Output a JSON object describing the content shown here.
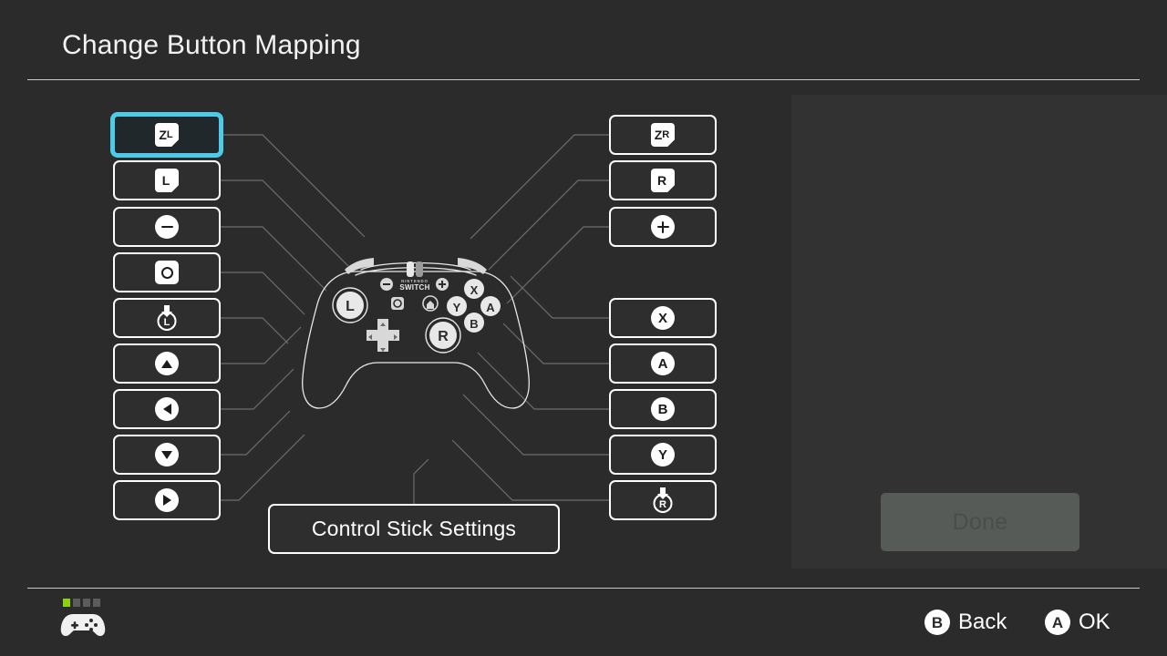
{
  "header": {
    "title": "Change Button Mapping"
  },
  "left_column": [
    {
      "id": "zl",
      "label": "ZL",
      "icon": "shoulder-zl-icon",
      "glyph": "shoulder",
      "main": "Z",
      "sub": "L",
      "selected": true
    },
    {
      "id": "l",
      "label": "L",
      "icon": "shoulder-l-icon",
      "glyph": "shoulder",
      "main": "L",
      "sub": "",
      "selected": false
    },
    {
      "id": "minus",
      "label": "Minus",
      "icon": "minus-button-icon",
      "glyph": "minus",
      "main": "",
      "sub": "",
      "selected": false
    },
    {
      "id": "capture",
      "label": "Capture",
      "icon": "capture-button-icon",
      "glyph": "capture",
      "main": "",
      "sub": "",
      "selected": false
    },
    {
      "id": "lstick",
      "label": "L Stick Press",
      "icon": "left-stick-press-icon",
      "glyph": "stick",
      "main": "L",
      "sub": "",
      "selected": false
    },
    {
      "id": "dup",
      "label": "D-Pad Up",
      "icon": "dpad-up-icon",
      "glyph": "tri-up",
      "main": "",
      "sub": "",
      "selected": false
    },
    {
      "id": "dleft",
      "label": "D-Pad Left",
      "icon": "dpad-left-icon",
      "glyph": "tri-left",
      "main": "",
      "sub": "",
      "selected": false
    },
    {
      "id": "ddown",
      "label": "D-Pad Down",
      "icon": "dpad-down-icon",
      "glyph": "tri-down",
      "main": "",
      "sub": "",
      "selected": false
    },
    {
      "id": "dright",
      "label": "D-Pad Right",
      "icon": "dpad-right-icon",
      "glyph": "tri-right",
      "main": "",
      "sub": "",
      "selected": false
    }
  ],
  "right_column": [
    {
      "id": "zr",
      "label": "ZR",
      "icon": "shoulder-zr-icon",
      "glyph": "shoulder",
      "main": "Z",
      "sub": "R",
      "selected": false
    },
    {
      "id": "r",
      "label": "R",
      "icon": "shoulder-r-icon",
      "glyph": "shoulder",
      "main": "R",
      "sub": "",
      "selected": false
    },
    {
      "id": "plus",
      "label": "Plus",
      "icon": "plus-button-icon",
      "glyph": "plus",
      "main": "",
      "sub": "",
      "selected": false
    },
    {
      "id": "gap",
      "label": "",
      "icon": "",
      "glyph": "gap",
      "main": "",
      "sub": "",
      "selected": false
    },
    {
      "id": "x",
      "label": "X",
      "icon": "x-button-icon",
      "glyph": "letter",
      "main": "X",
      "sub": "",
      "selected": false
    },
    {
      "id": "a",
      "label": "A",
      "icon": "a-button-icon",
      "glyph": "letter",
      "main": "A",
      "sub": "",
      "selected": false
    },
    {
      "id": "b",
      "label": "B",
      "icon": "b-button-icon",
      "glyph": "letter",
      "main": "B",
      "sub": "",
      "selected": false
    },
    {
      "id": "y",
      "label": "Y",
      "icon": "y-button-icon",
      "glyph": "letter",
      "main": "Y",
      "sub": "",
      "selected": false
    },
    {
      "id": "rstick",
      "label": "R Stick Press",
      "icon": "right-stick-press-icon",
      "glyph": "stick",
      "main": "R",
      "sub": "",
      "selected": false
    }
  ],
  "controller": {
    "brand_line1": "NINTENDO",
    "brand_line2": "SWITCH",
    "left_stick_label": "L",
    "right_stick_label": "R",
    "face_buttons": [
      "X",
      "A",
      "B",
      "Y"
    ]
  },
  "stick_settings": {
    "label": "Control Stick Settings"
  },
  "done": {
    "label": "Done",
    "enabled": false
  },
  "footer": {
    "battery_segments": 4,
    "battery_filled": 1,
    "controller_icon": "gamepad-icon",
    "hints": [
      {
        "badge": "B",
        "label": "Back"
      },
      {
        "badge": "A",
        "label": "OK"
      }
    ]
  },
  "colors": {
    "background": "#2b2b2b",
    "panel": "#323232",
    "accent": "#4ecbe8",
    "button_border": "#ffffff",
    "battery_on": "#8fd400",
    "wire": "#6e6e6e"
  }
}
